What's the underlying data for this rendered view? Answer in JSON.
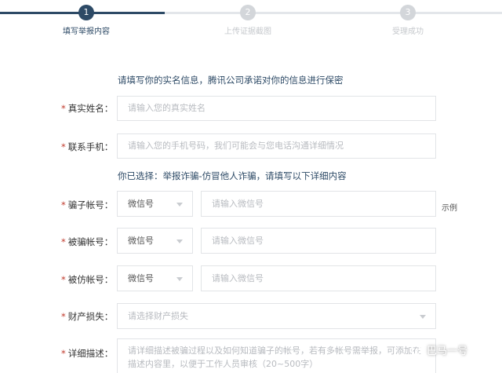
{
  "steps": [
    {
      "number": "1",
      "label": "填写举报内容",
      "state": "active"
    },
    {
      "number": "2",
      "label": "上传证据截图",
      "state": "inactive"
    },
    {
      "number": "3",
      "label": "受理成功",
      "state": "inactive"
    }
  ],
  "notice": "请填写你的实名信息，腾讯公司承诺对你的信息进行保密",
  "selection_notice": "你已选择：举报诈骗-仿冒他人诈骗，请填写以下详细内容",
  "fields": {
    "real_name": {
      "label": "真实姓名：",
      "placeholder": "请输入您的真实姓名"
    },
    "phone": {
      "label": "联系手机：",
      "placeholder": "请输入您的手机号码，我们可能会与您电话沟通详细情况"
    },
    "scammer_account": {
      "label": "骗子帐号：",
      "type_value": "微信号",
      "placeholder": "请输入微信号",
      "example": "示例"
    },
    "victim_account": {
      "label": "被骗帐号：",
      "type_value": "微信号",
      "placeholder": "请输入微信号"
    },
    "impersonated_account": {
      "label": "被仿帐号：",
      "type_value": "微信号",
      "placeholder": "请输入微信号"
    },
    "property_loss": {
      "label": "财产损失：",
      "placeholder": "请选择财产损失"
    },
    "details": {
      "label": "详细描述：",
      "placeholder_line1": "请详细描述被骗过程以及如何知道骗子的帐号，若有多帐号需举报，可添加在",
      "placeholder_line2": "描述内容里，以便于工作人员审核（20~500字）"
    }
  },
  "required_mark": "*",
  "watermark": "巴马一号",
  "colors": {
    "accent": "#2d4a66",
    "required": "#c0392b"
  }
}
